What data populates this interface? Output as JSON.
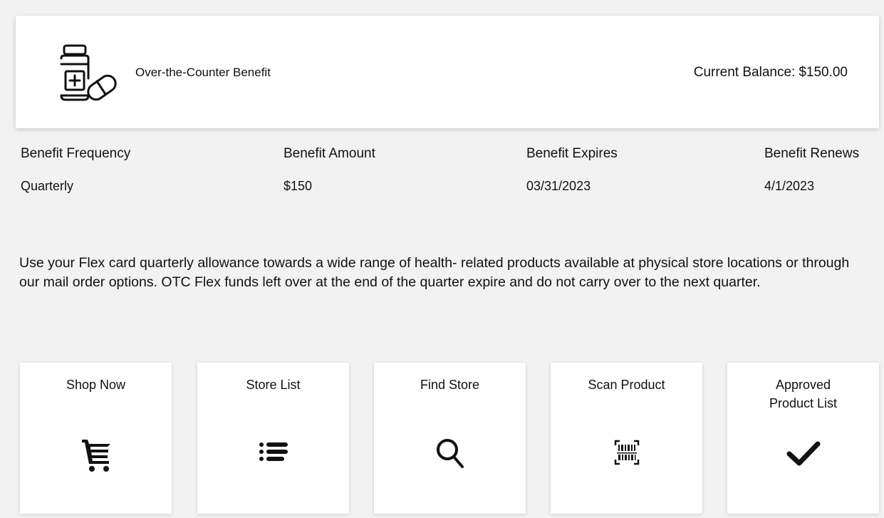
{
  "header": {
    "icon": "medicine-bottle-pill-icon",
    "title": "Over-the-Counter Benefit",
    "balance_label": "Current Balance:",
    "balance_value": "$150.00"
  },
  "details": [
    {
      "label": "Benefit Frequency",
      "value": "Quarterly"
    },
    {
      "label": "Benefit Amount",
      "value": "$150"
    },
    {
      "label": "Benefit Expires",
      "value": "03/31/2023"
    },
    {
      "label": "Benefit Renews",
      "value": "4/1/2023"
    }
  ],
  "description": "Use your Flex card quarterly allowance towards a wide range of health- related products available at physical store locations or through our mail order options. OTC Flex funds left over at the end of the quarter expire and do not carry over to the next quarter.",
  "actions": [
    {
      "label": "Shop Now",
      "icon": "shopping-cart-icon"
    },
    {
      "label": "Store List",
      "icon": "list-icon"
    },
    {
      "label": "Find Store",
      "icon": "search-icon"
    },
    {
      "label": "Scan Product",
      "icon": "barcode-scan-icon"
    },
    {
      "label": "Approved\nProduct List",
      "icon": "checkmark-icon"
    }
  ],
  "colors": {
    "background": "#f2f2f2",
    "card": "#ffffff",
    "text": "#111111"
  }
}
